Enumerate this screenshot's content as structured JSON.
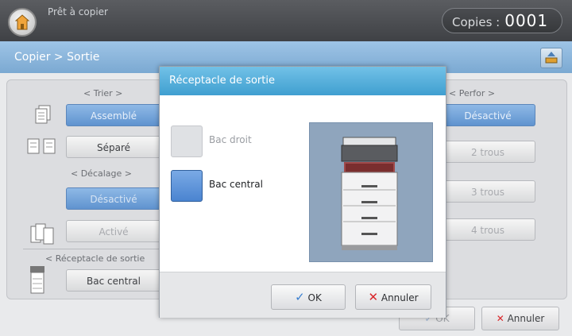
{
  "header": {
    "status": "Prêt à copier",
    "copies_label": "Copies :",
    "copies_value": "0001"
  },
  "breadcrumb": "Copier > Sortie",
  "sections": {
    "trier": {
      "title": "< Trier >",
      "assemble": "Assemblé",
      "separe": "Séparé"
    },
    "decalage": {
      "title": "< Décalage >",
      "desactive": "Désactivé",
      "active": "Activé"
    },
    "receptacle": {
      "title": "< Réceptacle de sortie",
      "value": "Bac central"
    },
    "perfor": {
      "title": "< Perfor >",
      "desactive": "Désactivé",
      "two": "2 trous",
      "three": "3 trous",
      "four": "4 trous"
    }
  },
  "bottom": {
    "ok": "OK",
    "cancel": "Annuler"
  },
  "dialog": {
    "title": "Réceptacle de sortie",
    "options": [
      {
        "label": "Bac droit",
        "selected": false
      },
      {
        "label": "Bac central",
        "selected": true
      }
    ],
    "ok": "OK",
    "cancel": "Annuler"
  },
  "colors": {
    "accent_blue": "#5f93cf",
    "dialog_title": "#3f9fd0",
    "cancel_x": "#d9262a",
    "ok_check": "#3a7fd0"
  }
}
